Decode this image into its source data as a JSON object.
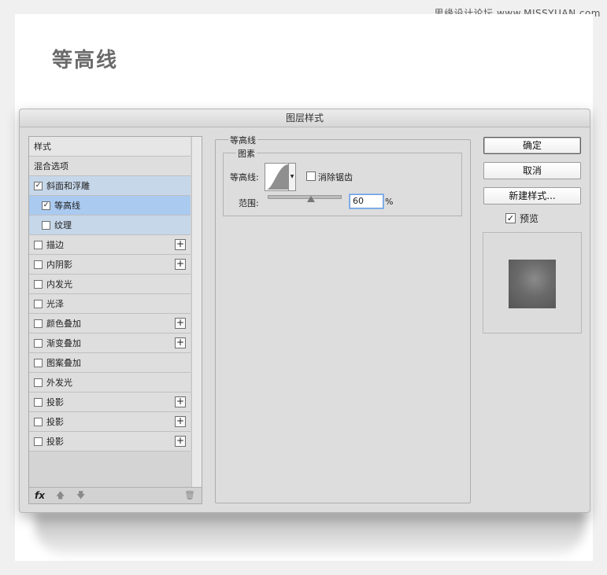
{
  "watermark": "思缘设计论坛 www.MISSYUAN.com",
  "page_title": "等高线",
  "dialog": {
    "title": "图层样式",
    "style_list": {
      "header": "样式",
      "items": [
        {
          "label": "混合选项",
          "checkbox": false,
          "checked": false,
          "plus": false,
          "state": "normal"
        },
        {
          "label": "斜面和浮雕",
          "checkbox": true,
          "checked": true,
          "plus": false,
          "state": "sel-parent"
        },
        {
          "label": "等高线",
          "checkbox": true,
          "checked": true,
          "plus": false,
          "state": "sel"
        },
        {
          "label": "纹理",
          "checkbox": true,
          "checked": false,
          "plus": false,
          "state": "sub"
        },
        {
          "label": "描边",
          "checkbox": true,
          "checked": false,
          "plus": true,
          "state": "normal"
        },
        {
          "label": "内阴影",
          "checkbox": true,
          "checked": false,
          "plus": true,
          "state": "normal"
        },
        {
          "label": "内发光",
          "checkbox": true,
          "checked": false,
          "plus": false,
          "state": "normal"
        },
        {
          "label": "光泽",
          "checkbox": true,
          "checked": false,
          "plus": false,
          "state": "normal"
        },
        {
          "label": "颜色叠加",
          "checkbox": true,
          "checked": false,
          "plus": true,
          "state": "normal"
        },
        {
          "label": "渐变叠加",
          "checkbox": true,
          "checked": false,
          "plus": true,
          "state": "normal"
        },
        {
          "label": "图案叠加",
          "checkbox": true,
          "checked": false,
          "plus": false,
          "state": "normal"
        },
        {
          "label": "外发光",
          "checkbox": true,
          "checked": false,
          "plus": false,
          "state": "normal"
        },
        {
          "label": "投影",
          "checkbox": true,
          "checked": false,
          "plus": true,
          "state": "normal"
        },
        {
          "label": "投影",
          "checkbox": true,
          "checked": false,
          "plus": true,
          "state": "normal"
        },
        {
          "label": "投影",
          "checkbox": true,
          "checked": false,
          "plus": true,
          "state": "normal"
        }
      ],
      "footer": {
        "fx_label": "fx",
        "up_icon": "arrow-up-icon",
        "down_icon": "arrow-down-icon",
        "trash_icon": "trash-icon"
      }
    },
    "contour_panel": {
      "group_title": "等高线",
      "subgroup_title": "图素",
      "contour_label": "等高线:",
      "anti_alias_label": "消除锯齿",
      "anti_alias_checked": false,
      "range_label": "范围:",
      "range_value": "60",
      "range_unit": "%",
      "range_percent": 60
    },
    "buttons": {
      "ok": "确定",
      "cancel": "取消",
      "new_style": "新建样式..."
    },
    "preview": {
      "label": "预览",
      "checked": true
    }
  }
}
